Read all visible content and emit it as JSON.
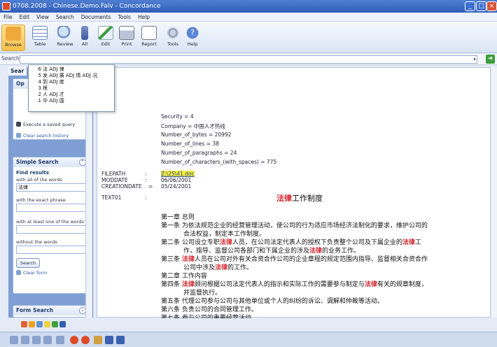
{
  "window": {
    "title": "0708.2008 - Chinese.Demo.Falv - Concordance"
  },
  "menu": [
    "File",
    "Edit",
    "View",
    "Search",
    "Documents",
    "Tools",
    "Help"
  ],
  "toolbar": {
    "items": [
      {
        "label": "Browse",
        "icon": "browse-icon"
      },
      {
        "label": "Table",
        "icon": "table-icon"
      },
      {
        "label": "Review",
        "icon": "review-icon"
      },
      {
        "label": "All",
        "icon": "all-icon"
      },
      {
        "label": "Edit",
        "icon": "edit-icon"
      },
      {
        "label": "Print",
        "icon": "print-icon"
      },
      {
        "label": "Report",
        "icon": "report-icon"
      },
      {
        "label": "Tools",
        "icon": "tools-icon"
      },
      {
        "label": "Help",
        "icon": "help-icon"
      }
    ]
  },
  "search": {
    "label": "Search",
    "tab_label": "Sear",
    "value": ""
  },
  "dropdown": [
    {
      "count": "6",
      "text": "法 ADJ 律"
    },
    {
      "count": "5",
      "text": "发 ADJ 展 ADJ 情 ADJ 况"
    },
    {
      "count": "4",
      "text": "到 ADJ 度"
    },
    {
      "count": "3",
      "text": "根"
    },
    {
      "count": "2",
      "text": "人 ADJ 才"
    },
    {
      "count": "1",
      "text": "中 ADJ 国"
    }
  ],
  "left": {
    "options_title": "Op",
    "execute_saved": "Execute a saved query",
    "clear_history": "Clear search history",
    "simple_search": {
      "title": "Simple Search",
      "find_results": "Find results",
      "all_words_label": "with all of the words",
      "all_words_value": "法律",
      "exact_phrase_label": "with the exact phrase",
      "at_least_one_label": "with at least one of the words",
      "without_label": "without the words",
      "search_button": "Search",
      "clear_form": "Clear form"
    },
    "form_search": "Form Search"
  },
  "document": {
    "meta": [
      "Security = 4",
      "Company = 中国人才热线",
      "Number_of_bytes = 20992",
      "Number_of_lines = 38",
      "Number_of_paragraphs = 24",
      "Number_of_characters_(with_spaces) = 775"
    ],
    "fields": [
      {
        "key": "FILEPATH",
        "value": "Z:\\25\\41.doc"
      },
      {
        "key": "MODDATE",
        "value": "06/06/2001"
      },
      {
        "key": "CREATIONDATE",
        "value": "05/24/2001"
      },
      {
        "key": "TEXT01",
        "value": ""
      }
    ],
    "title_hl": "法律",
    "title_rest": "工作制度",
    "lines": {
      "l1": "第一章 总则",
      "l2a": "第一条  为依法规范企业的经营管理活动，使公司的行为适应市场经济法制化的要求，维护公司的",
      "l2b": "合法权益，制定本工作制度。",
      "l3a_pre": "第二条    公司设立专职",
      "l3a_hl": "法律",
      "l3a_mid": "人员，在公司法定代表人的授权下负责整个公司及下属企业的",
      "l3a_hl2": "法律",
      "l3a_post": "工",
      "l3b_pre": "作，指导、监督公司各部门和下属企业的涉及",
      "l3b_hl": "法律",
      "l3b_post": "的业务工作。",
      "l4a_pre": "第三条 ",
      "l4a_hl": "法律",
      "l4a_post": "人员在公司对外有关合资合作公司的企业章程的规定范围内指导、监督相关合资合作",
      "l4b_pre": "公司中涉及",
      "l4b_hl": "法律",
      "l4b_post": "的工作。",
      "l5": "第二章 工作内容",
      "l6a_pre": "第四条 ",
      "l6a_hl": "法律",
      "l6a_mid": "顾问根据公司法定代表人的指示和实际工作的需要参与制定与",
      "l6a_hl2": "法律",
      "l6a_post": "有关的规章制度，",
      "l6b": "并监督执行。",
      "l7": "第五条 代理公司参与公司与其他单位或个人的纠纷的诉讼、调解和仲裁等活动。",
      "l8": "第六条 负责公司的合同管理工作。",
      "l9": "第七条 参与公司的重要经营活动"
    }
  }
}
